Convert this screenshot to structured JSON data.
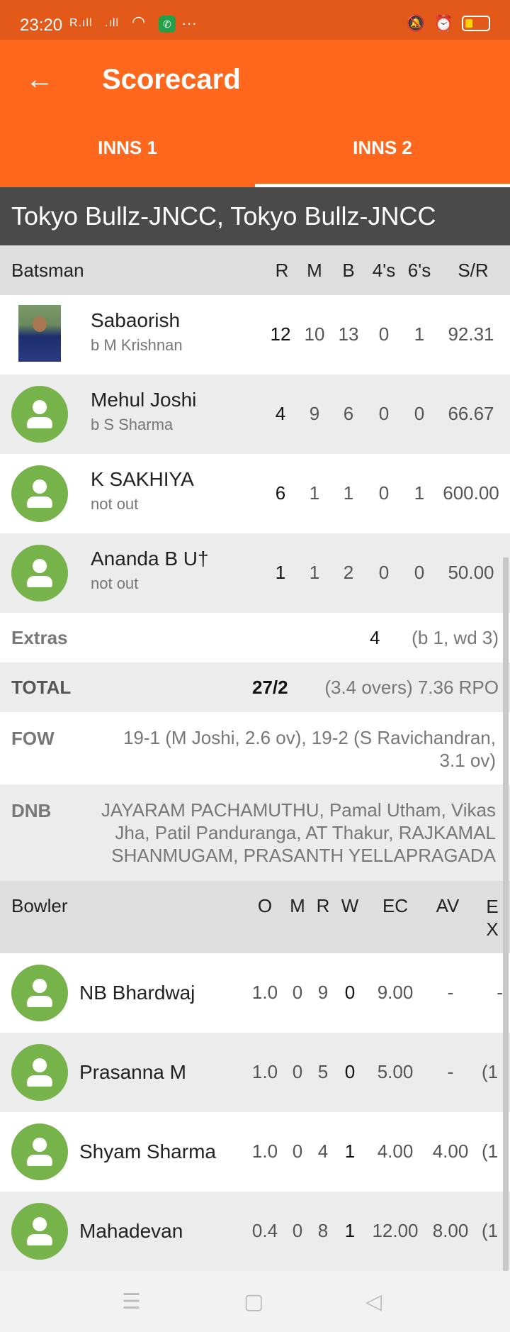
{
  "status": {
    "time": "23:20",
    "signal1": "R.ıll",
    "signal2": ".ıll",
    "dots": "···"
  },
  "toolbar": {
    "title": "Scorecard",
    "back": "←"
  },
  "tabs": [
    {
      "label": "INNS 1"
    },
    {
      "label": "INNS 2"
    }
  ],
  "team": "Tokyo Bullz-JNCC, Tokyo Bullz-JNCC",
  "batting": {
    "header": {
      "label": "Batsman",
      "r": "R",
      "m": "M",
      "b": "B",
      "fours": "4's",
      "sixes": "6's",
      "sr": "S/R"
    },
    "rows": [
      {
        "name": "Sabaorish",
        "dismissal": "b M Krishnan",
        "r": "12",
        "m": "10",
        "b": "13",
        "fours": "0",
        "sixes": "1",
        "sr": "92.31"
      },
      {
        "name": "Mehul Joshi",
        "dismissal": "b S Sharma",
        "r": "4",
        "m": "9",
        "b": "6",
        "fours": "0",
        "sixes": "0",
        "sr": "66.67"
      },
      {
        "name": "K SAKHIYA",
        "dismissal": "not out",
        "r": "6",
        "m": "1",
        "b": "1",
        "fours": "0",
        "sixes": "1",
        "sr": "600.00"
      },
      {
        "name": "Ananda B U†",
        "dismissal": "not out",
        "r": "1",
        "m": "1",
        "b": "2",
        "fours": "0",
        "sixes": "0",
        "sr": "50.00"
      }
    ]
  },
  "extras": {
    "label": "Extras",
    "value": "4",
    "detail": "(b 1, wd 3)"
  },
  "total": {
    "label": "TOTAL",
    "value": "27/2",
    "detail": "(3.4 overs) 7.36 RPO"
  },
  "fow": {
    "label": "FOW",
    "line1": "19-1 (M Joshi, 2.6 ov), 19-2 (S Ravichandran,",
    "line2": "3.1 ov)"
  },
  "dnb": {
    "label": "DNB",
    "line1": "JAYARAM PACHAMUTHU, Pamal Utham, Vikas",
    "line2": "Jha, Patil Panduranga, AT Thakur, RAJKAMAL",
    "line3": "SHANMUGAM, PRASANTH YELLAPRAGADA"
  },
  "bowling": {
    "header": {
      "label": "Bowler",
      "o": "O",
      "m": "M",
      "r": "R",
      "w": "W",
      "ec": "EC",
      "av": "AV",
      "ex1": "E",
      "ex2": "X"
    },
    "rows": [
      {
        "name": "NB Bhardwaj",
        "o": "1.0",
        "m": "0",
        "r": "9",
        "w": "0",
        "ec": "9.00",
        "av": "-",
        "ex": "-"
      },
      {
        "name": "Prasanna M",
        "o": "1.0",
        "m": "0",
        "r": "5",
        "w": "0",
        "ec": "5.00",
        "av": "-",
        "ex": "(1"
      },
      {
        "name": "Shyam Sharma",
        "o": "1.0",
        "m": "0",
        "r": "4",
        "w": "1",
        "ec": "4.00",
        "av": "4.00",
        "ex": "(1"
      },
      {
        "name": "Mahadevan",
        "o": "0.4",
        "m": "0",
        "r": "8",
        "w": "1",
        "ec": "12.00",
        "av": "8.00",
        "ex": "(1"
      }
    ]
  },
  "nav": {
    "menu": "☰",
    "home": "▢",
    "back": "◁"
  }
}
